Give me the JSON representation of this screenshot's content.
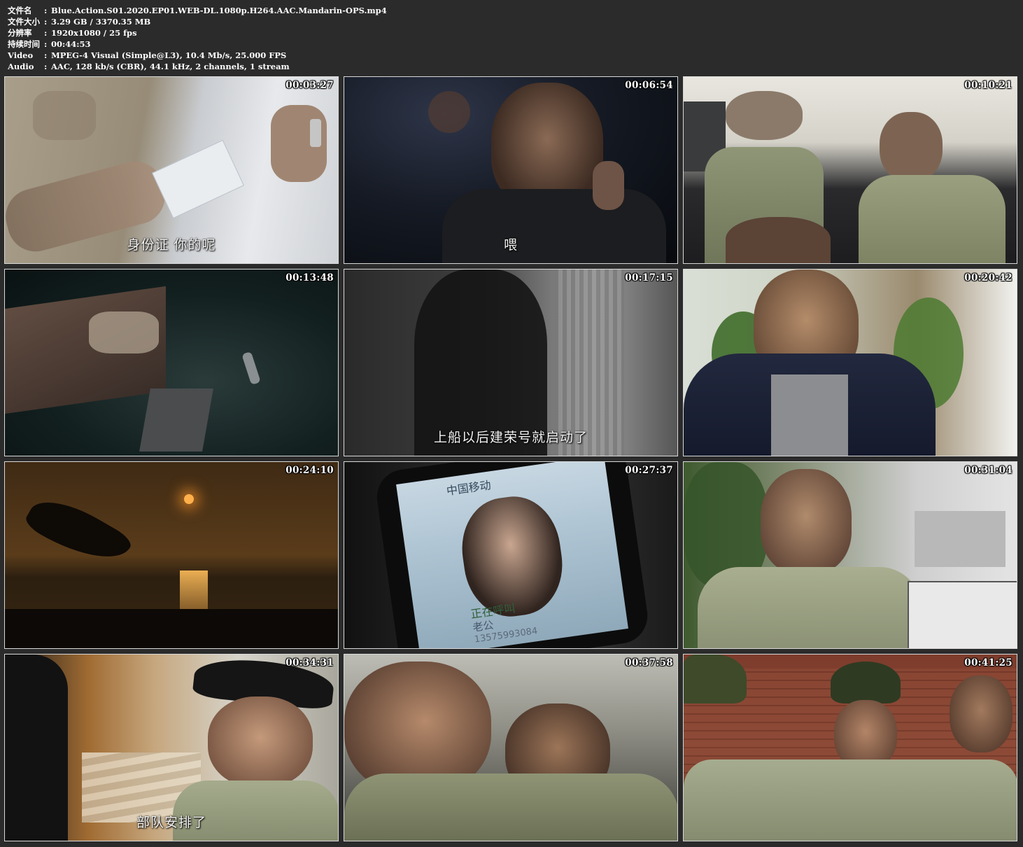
{
  "meta": {
    "rows": [
      {
        "label": "文件名",
        "value": "Blue.Action.S01.2020.EP01.WEB-DL.1080p.H264.AAC.Mandarin-OPS.mp4"
      },
      {
        "label": "文件大小",
        "value": "3.29 GB  / 3370.35 MB"
      },
      {
        "label": "分辨率",
        "value": "1920x1080 / 25 fps"
      },
      {
        "label": "持续时间",
        "value": "00:44:53"
      },
      {
        "label": "Video",
        "value": "MPEG-4 Visual (Simple@L3), 10.4 Mb/s, 25.000 FPS"
      },
      {
        "label": "Audio",
        "value": "AAC, 128 kb/s (CBR), 44.1 kHz, 2 channels, 1 stream"
      }
    ],
    "separator": ":"
  },
  "thumbs": [
    {
      "time": "00:03:27",
      "subtitle": "身份证  你的呢"
    },
    {
      "time": "00:06:54",
      "subtitle": "喂"
    },
    {
      "time": "00:10:21",
      "subtitle": ""
    },
    {
      "time": "00:13:48",
      "subtitle": ""
    },
    {
      "time": "00:17:15",
      "subtitle": "上船以后建荣号就启动了"
    },
    {
      "time": "00:20:42",
      "subtitle": ""
    },
    {
      "time": "00:24:10",
      "subtitle": ""
    },
    {
      "time": "00:27:37",
      "subtitle": "",
      "phone": {
        "carrier": "中国移动",
        "status": "正在呼叫",
        "contact": "老公",
        "number": "13575993084"
      }
    },
    {
      "time": "00:31:04",
      "subtitle": ""
    },
    {
      "time": "00:34:31",
      "subtitle": "部队安排了"
    },
    {
      "time": "00:37:58",
      "subtitle": ""
    },
    {
      "time": "00:41:25",
      "subtitle": ""
    }
  ]
}
